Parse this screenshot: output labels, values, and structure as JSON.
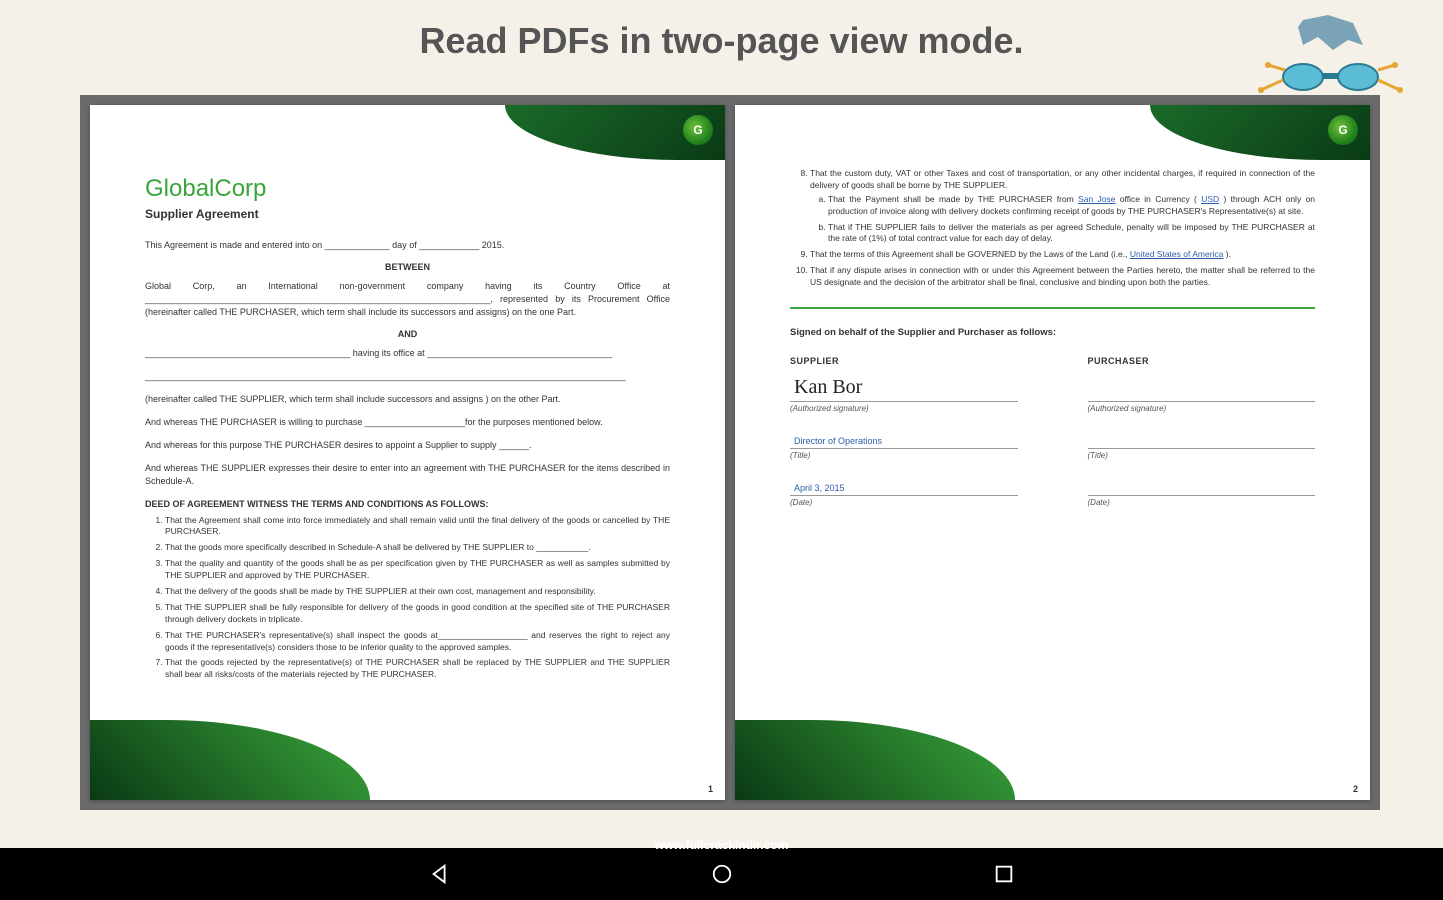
{
  "headline": "Read PDFs in two-page view mode.",
  "footer_url": "www.fullcrackindir.com",
  "page1": {
    "corp": "GlobalCorp",
    "subtitle": "Supplier Agreement",
    "intro": "This Agreement is made and entered into on _____________ day of ____________ 2015.",
    "between": "BETWEEN",
    "p1a": "Global Corp, an International non-government company having its Country Office at",
    "p1b": "_____________________________________________________________________, represented by its Procurement Office (hereinafter called THE PURCHASER, which term shall include its successors and assigns) on the one Part.",
    "and": "AND",
    "p2a": "_________________________________________ having its office at _____________________________________",
    "p2b": "________________________________________________________________________________________________",
    "p3": "(hereinafter called THE SUPPLIER, which term shall include successors and assigns ) on the other Part.",
    "p4": "And whereas THE PURCHASER is willing to purchase ____________________for the purposes mentioned below.",
    "p5": "And whereas for this purpose THE PURCHASER desires to appoint a Supplier to supply ______.",
    "p6": "And whereas THE SUPPLIER expresses their desire to enter into an agreement with THE PURCHASER for the items described in Schedule-A.",
    "deed": "DEED OF AGREEMENT WITNESS THE TERMS AND CONDITIONS AS FOLLOWS:",
    "terms": [
      "That the Agreement shall come into force immediately and shall remain valid until the final delivery of the goods or cancelled by THE PURCHASER.",
      "That the goods more specifically described in Schedule-A shall be delivered by THE SUPPLIER to ___________.",
      "That the quality and quantity of the goods shall be as per specification given by THE PURCHASER as well as samples submitted by THE SUPPLIER and approved by THE PURCHASER.",
      "That the delivery of the goods shall be made by THE SUPPLIER at their own cost, management and responsibility.",
      "That THE SUPPLIER  shall be fully responsible for delivery of the goods  in good condition at the specified site of THE PURCHASER through delivery dockets in triplicate.",
      "That THE PURCHASER's representative(s) shall inspect the goods at___________________ and reserves the right to reject any goods if the representative(s) considers those to be inferior quality to the approved samples.",
      "That the goods rejected by the representative(s) of THE PURCHASER shall be replaced by THE SUPPLIER and THE SUPPLIER  shall bear all risks/costs of the materials rejected by THE PURCHASER."
    ],
    "pagenum": "1"
  },
  "page2": {
    "terms": {
      "t8": "That the custom duty, VAT or other Taxes and cost of transportation, or any other incidental charges, if required in connection of the delivery of goods shall be borne by THE SUPPLIER.",
      "t8a_pre": "That the Payment shall be made by THE PURCHASER from ",
      "t8a_city": "San Jose",
      "t8a_mid1": " office in Currency ( ",
      "t8a_currency": "USD",
      "t8a_post": " ) through ACH only on production of invoice along with delivery dockets confirming receipt of goods by THE PURCHASER's Representative(s) at site.",
      "t8b": "That if THE SUPPLIER fails to deliver the materials as per agreed Schedule, penalty will be imposed by THE PURCHASER at the rate of (1%) of total contract value for each day of delay.",
      "t9_pre": "That the terms of this Agreement shall be GOVERNED by the Laws of the Land (i.e., ",
      "t9_country": "United States of America",
      "t9_post": " ).",
      "t10": "That if any dispute arises in connection with or under this Agreement between the Parties hereto, the matter shall be referred to the US designate and the decision of the arbitrator shall be final, conclusive and binding upon both the parties."
    },
    "sign_title": "Signed on behalf of the Supplier and Purchaser as follows:",
    "supplier": {
      "head": "SUPPLIER",
      "sig": "Kan Bor",
      "auth": "(Authorized signature)",
      "title_val": "Director of Operations",
      "title_lbl": "(Title)",
      "date_val": "April 3, 2015",
      "date_lbl": "(Date)"
    },
    "purchaser": {
      "head": "PURCHASER",
      "auth": "(Authorized signature)",
      "title_lbl": "(Title)",
      "date_lbl": "(Date)"
    },
    "pagenum": "2"
  }
}
